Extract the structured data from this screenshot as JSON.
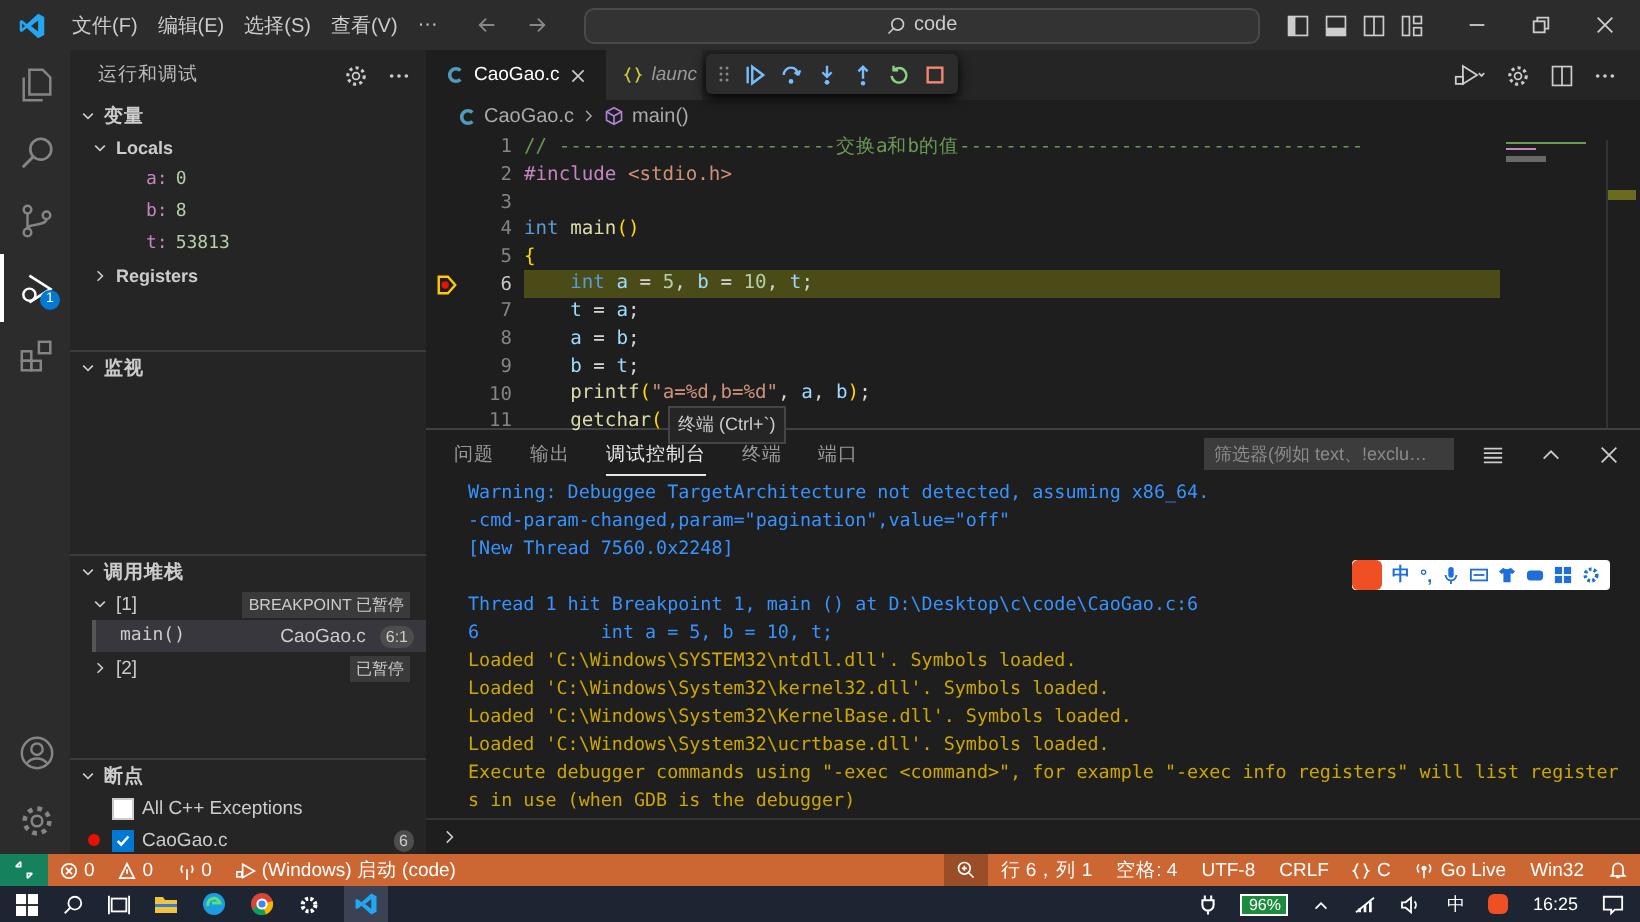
{
  "title_bar": {
    "menu": [
      "文件(F)",
      "编辑(E)",
      "选择(S)",
      "查看(V)",
      "···"
    ],
    "search": "code"
  },
  "activity_bar": [
    {
      "kind": "files",
      "selected": false
    },
    {
      "kind": "search",
      "selected": false
    },
    {
      "kind": "source-control",
      "selected": false
    },
    {
      "kind": "debug",
      "selected": true,
      "badge": "1"
    },
    {
      "kind": "extensions",
      "selected": false
    }
  ],
  "sidebar": {
    "title": "运行和调试",
    "variables": {
      "title": "变量",
      "expanded": true,
      "groups": [
        {
          "label": "Locals",
          "expanded": true,
          "children": [
            {
              "name": "a:",
              "value": "0"
            },
            {
              "name": "b:",
              "value": "8"
            },
            {
              "name": "t:",
              "value": "53813"
            }
          ]
        },
        {
          "label": "Registers",
          "expanded": false
        }
      ]
    },
    "watch": {
      "title": "监视",
      "expanded": true
    },
    "call_stack": {
      "title": "调用堆栈",
      "expanded": true,
      "threads": [
        {
          "label": "[1]",
          "expanded": true,
          "status": "BREAKPOINT 已暂停",
          "frames": [
            {
              "name": "main()",
              "file": "CaoGao.c",
              "position": "6:1",
              "selected": true
            }
          ]
        },
        {
          "label": "[2]",
          "expanded": false,
          "status": "已暂停"
        }
      ]
    },
    "breakpoints": {
      "title": "断点",
      "expanded": true,
      "items": [
        {
          "label": "All C++ Exceptions",
          "checked": false
        },
        {
          "label": "CaoGao.c",
          "checked": true,
          "count": "6"
        }
      ]
    }
  },
  "editor": {
    "tabs": [
      {
        "label": "CaoGao.c",
        "kind": "c",
        "selected": true
      },
      {
        "label": "launc",
        "kind": "json",
        "selected": false
      }
    ],
    "breadcrumb": [
      "CaoGao.c",
      "main()"
    ],
    "lines": [
      {
        "number": "1",
        "current": false,
        "breakpoint": false,
        "tokens": [
          {
            "color": "#6a9955",
            "text": "// ------------------------交换a和b的值-----------------------------------"
          }
        ]
      },
      {
        "number": "2",
        "current": false,
        "breakpoint": false,
        "tokens": [
          {
            "color": "#c586c0",
            "text": "#include "
          },
          {
            "color": "#ce9178",
            "text": "<stdio.h>"
          }
        ]
      },
      {
        "number": "3",
        "current": false,
        "breakpoint": false
      },
      {
        "number": "4",
        "current": false,
        "breakpoint": false,
        "tokens": [
          {
            "color": "#569cd6",
            "text": "int "
          },
          {
            "color": "#dcdcaa",
            "text": "main"
          },
          {
            "color": "#ffd700",
            "text": "()"
          }
        ]
      },
      {
        "number": "5",
        "current": false,
        "breakpoint": false,
        "tokens": [
          {
            "color": "#ffd700",
            "text": "{"
          }
        ]
      },
      {
        "number": "6",
        "current": true,
        "breakpoint": true,
        "tokens": [
          {
            "color": "#569cd6",
            "text": "    int "
          },
          {
            "color": "#9cdcfe",
            "text": "a"
          },
          {
            "color": "#d4d4d4",
            "text": " = "
          },
          {
            "color": "#b5cea8",
            "text": "5"
          },
          {
            "color": "#d4d4d4",
            "text": ", "
          },
          {
            "color": "#9cdcfe",
            "text": "b"
          },
          {
            "color": "#d4d4d4",
            "text": " = "
          },
          {
            "color": "#b5cea8",
            "text": "10"
          },
          {
            "color": "#d4d4d4",
            "text": ", "
          },
          {
            "color": "#9cdcfe",
            "text": "t"
          },
          {
            "color": "#d4d4d4",
            "text": ";"
          }
        ]
      },
      {
        "number": "7",
        "current": false,
        "breakpoint": false,
        "tokens": [
          {
            "color": "#9cdcfe",
            "text": "    t"
          },
          {
            "color": "#d4d4d4",
            "text": " = "
          },
          {
            "color": "#9cdcfe",
            "text": "a"
          },
          {
            "color": "#d4d4d4",
            "text": ";"
          }
        ]
      },
      {
        "number": "8",
        "current": false,
        "breakpoint": false,
        "tokens": [
          {
            "color": "#9cdcfe",
            "text": "    a"
          },
          {
            "color": "#d4d4d4",
            "text": " = "
          },
          {
            "color": "#9cdcfe",
            "text": "b"
          },
          {
            "color": "#d4d4d4",
            "text": ";"
          }
        ]
      },
      {
        "number": "9",
        "current": false,
        "breakpoint": false,
        "tokens": [
          {
            "color": "#9cdcfe",
            "text": "    b"
          },
          {
            "color": "#d4d4d4",
            "text": " = "
          },
          {
            "color": "#9cdcfe",
            "text": "t"
          },
          {
            "color": "#d4d4d4",
            "text": ";"
          }
        ]
      },
      {
        "number": "10",
        "current": false,
        "breakpoint": false,
        "tokens": [
          {
            "color": "#dcdcaa",
            "text": "    printf"
          },
          {
            "color": "#ffd700",
            "text": "("
          },
          {
            "color": "#ce9178",
            "text": "\"a=%d,b=%d\""
          },
          {
            "color": "#d4d4d4",
            "text": ", "
          },
          {
            "color": "#9cdcfe",
            "text": "a"
          },
          {
            "color": "#d4d4d4",
            "text": ", "
          },
          {
            "color": "#9cdcfe",
            "text": "b"
          },
          {
            "color": "#ffd700",
            "text": ")"
          },
          {
            "color": "#d4d4d4",
            "text": ";"
          }
        ]
      },
      {
        "number": "11",
        "current": false,
        "breakpoint": false,
        "tokens": [
          {
            "color": "#dcdcaa",
            "text": "    getchar"
          },
          {
            "color": "#ffd700",
            "text": "("
          }
        ]
      }
    ],
    "tooltip": "终端 (Ctrl+`)"
  },
  "panel": {
    "tabs": [
      {
        "label": "问题",
        "selected": false
      },
      {
        "label": "输出",
        "selected": false
      },
      {
        "label": "调试控制台",
        "selected": true
      },
      {
        "label": "终端",
        "selected": false
      },
      {
        "label": "端口",
        "selected": false
      }
    ],
    "filter": {
      "placeholder": "筛选器(例如 text、!exclu…"
    },
    "output": [
      {
        "kind": "info",
        "text": "Warning: Debuggee TargetArchitecture not detected, assuming x86_64."
      },
      {
        "kind": "info",
        "text": "-cmd-param-changed,param=\"pagination\",value=\"off\""
      },
      {
        "kind": "info",
        "text": "[New Thread 7560.0x2248]"
      },
      {
        "kind": "blank"
      },
      {
        "kind": "info",
        "text": "Thread 1 hit Breakpoint 1, main () at D:\\Desktop\\c\\code\\CaoGao.c:6"
      },
      {
        "kind": "info",
        "text": "6           int a = 5, b = 10, t;"
      },
      {
        "kind": "log",
        "text": "Loaded 'C:\\Windows\\SYSTEM32\\ntdll.dll'. Symbols loaded."
      },
      {
        "kind": "log",
        "text": "Loaded 'C:\\Windows\\System32\\kernel32.dll'. Symbols loaded."
      },
      {
        "kind": "log",
        "text": "Loaded 'C:\\Windows\\System32\\KernelBase.dll'. Symbols loaded."
      },
      {
        "kind": "log",
        "text": "Loaded 'C:\\Windows\\System32\\ucrtbase.dll'. Symbols loaded."
      },
      {
        "kind": "log",
        "text": "Execute debugger commands using \"-exec <command>\", for example \"-exec info registers\" will list registers in use (when GDB is the debugger)"
      }
    ]
  },
  "ime_bar": {
    "mode": "中",
    "punct": "°,"
  },
  "status_bar": {
    "left": [
      {
        "kind": "errors",
        "text": "0"
      },
      {
        "kind": "warnings",
        "text": "0"
      },
      {
        "kind": "ports",
        "text": "0"
      },
      {
        "kind": "launch",
        "text": "(Windows) 启动 (code)"
      }
    ],
    "right": [
      {
        "kind": "zoom"
      },
      {
        "kind": "plain",
        "text": "行 6，列 1"
      },
      {
        "kind": "plain",
        "text": "空格: 4"
      },
      {
        "kind": "plain",
        "text": "UTF-8"
      },
      {
        "kind": "plain",
        "text": "CRLF"
      },
      {
        "kind": "braces",
        "text": "C"
      },
      {
        "kind": "live",
        "text": "Go Live"
      },
      {
        "kind": "plain",
        "text": "Win32"
      },
      {
        "kind": "bell"
      }
    ]
  },
  "taskbar": {
    "battery": "96%",
    "ime": "中",
    "time": "16:25"
  }
}
